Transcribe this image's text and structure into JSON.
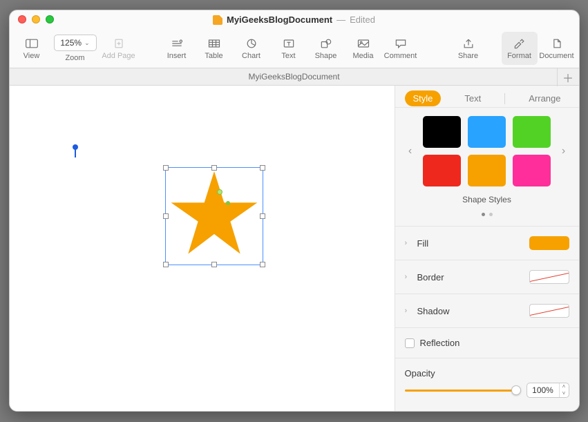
{
  "titlebar": {
    "title": "MyiGeeksBlogDocument",
    "separator": " — ",
    "status": "Edited"
  },
  "toolbar": {
    "view": "View",
    "zoom_label": "Zoom",
    "zoom_value": "125%",
    "add_page": "Add Page",
    "insert": "Insert",
    "table": "Table",
    "chart": "Chart",
    "text": "Text",
    "shape": "Shape",
    "media": "Media",
    "comment": "Comment",
    "share": "Share",
    "format": "Format",
    "document": "Document"
  },
  "doctab": {
    "name": "MyiGeeksBlogDocument"
  },
  "inspector": {
    "tabs": {
      "style": "Style",
      "text": "Text",
      "arrange": "Arrange"
    },
    "shape_styles_label": "Shape Styles",
    "rows": {
      "fill": "Fill",
      "border": "Border",
      "shadow": "Shadow",
      "reflection": "Reflection",
      "opacity": "Opacity"
    },
    "opacity_value": "100%",
    "colors": {
      "fill": "#f6a100",
      "swatches": [
        "#000000",
        "#28a3ff",
        "#53d226",
        "#ef281e",
        "#f6a100",
        "#ff2e9a"
      ]
    }
  },
  "shape": {
    "type": "star",
    "color": "#f6a100"
  }
}
